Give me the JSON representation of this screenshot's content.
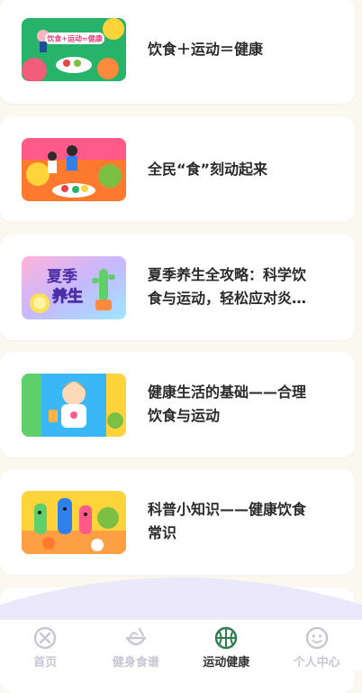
{
  "articles": [
    {
      "title": "饮食＋运动＝健康",
      "thumb_text": "饮食+运动=健康",
      "thumb_icon": "healthy-food-illustration"
    },
    {
      "title": "全民“食”刻动起来",
      "thumb_icon": "people-exercising-illustration"
    },
    {
      "title": "夏季养生全攻略：科学饮食与运动，轻松应对炎热夏天",
      "thumb_text_1": "夏季",
      "thumb_text_2": "养生",
      "thumb_icon": "summer-cactus-illustration"
    },
    {
      "title": "健康生活的基础——合理饮食与运动",
      "thumb_icon": "boy-with-drink-illustration"
    },
    {
      "title": "科普小知识——健康饮食常识",
      "thumb_icon": "vegetable-characters-illustration"
    }
  ],
  "tabs": [
    {
      "label": "首页",
      "icon": "home-icon",
      "active": false
    },
    {
      "label": "健身食谱",
      "icon": "food-bowl-icon",
      "active": false
    },
    {
      "label": "运动健康",
      "icon": "basketball-icon",
      "active": true
    },
    {
      "label": "个人中心",
      "icon": "smiley-face-icon",
      "active": false
    }
  ],
  "colors": {
    "active": "#2f7d4e",
    "inactive": "#c9c6d3",
    "background": "#fbf8ef",
    "wave": "#ece8fb"
  }
}
